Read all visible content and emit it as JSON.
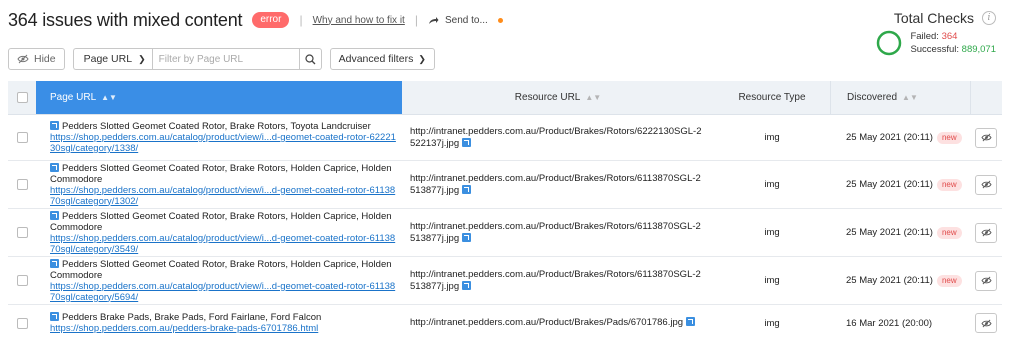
{
  "header": {
    "title": "364 issues with mixed content",
    "badge": "error",
    "why_link": "Why and how to fix it",
    "send_to": "Send to..."
  },
  "checks": {
    "title": "Total Checks",
    "failed_label": "Failed:",
    "failed_value": "364",
    "successful_label": "Successful:",
    "successful_value": "889,071",
    "colors": {
      "failed": "#e04b4b",
      "successful": "#2ea84a"
    }
  },
  "toolbar": {
    "hide_label": "Hide",
    "filter_select": "Page URL",
    "filter_placeholder": "Filter by Page URL",
    "advanced_label": "Advanced filters"
  },
  "table": {
    "columns": [
      "Page URL",
      "Resource URL",
      "Resource Type",
      "Discovered"
    ],
    "rows": [
      {
        "title": "Pedders Slotted Geomet Coated Rotor, Brake Rotors, Toyota Landcruiser",
        "url": "https://shop.pedders.com.au/catalog/product/view/i...d-geomet-coated-rotor-6222130sgl/category/1338/",
        "resource": "http://intranet.pedders.com.au/Product/Brakes/Rotors/6222130SGL-2522137j.jpg",
        "type": "img",
        "discovered": "25 May 2021 (20:11)",
        "new": "new"
      },
      {
        "title": "Pedders Slotted Geomet Coated Rotor, Brake Rotors, Holden Caprice, Holden Commodore",
        "url": "https://shop.pedders.com.au/catalog/product/view/i...d-geomet-coated-rotor-6113870sgl/category/1302/",
        "resource": "http://intranet.pedders.com.au/Product/Brakes/Rotors/6113870SGL-2513877j.jpg",
        "type": "img",
        "discovered": "25 May 2021 (20:11)",
        "new": "new"
      },
      {
        "title": "Pedders Slotted Geomet Coated Rotor, Brake Rotors, Holden Caprice, Holden Commodore",
        "url": "https://shop.pedders.com.au/catalog/product/view/i...d-geomet-coated-rotor-6113870sgl/category/3549/",
        "resource": "http://intranet.pedders.com.au/Product/Brakes/Rotors/6113870SGL-2513877j.jpg",
        "type": "img",
        "discovered": "25 May 2021 (20:11)",
        "new": "new"
      },
      {
        "title": "Pedders Slotted Geomet Coated Rotor, Brake Rotors, Holden Caprice, Holden Commodore",
        "url": "https://shop.pedders.com.au/catalog/product/view/i...d-geomet-coated-rotor-6113870sgl/category/5694/",
        "resource": "http://intranet.pedders.com.au/Product/Brakes/Rotors/6113870SGL-2513877j.jpg",
        "type": "img",
        "discovered": "25 May 2021 (20:11)",
        "new": "new"
      },
      {
        "title": "Pedders Brake Pads, Brake Pads, Ford Fairlane, Ford Falcon",
        "url": "https://shop.pedders.com.au/pedders-brake-pads-6701786.html",
        "resource": "http://intranet.pedders.com.au/Product/Brakes/Pads/6701786.jpg",
        "type": "img",
        "discovered": "16 Mar 2021 (20:00)",
        "new": ""
      }
    ]
  }
}
